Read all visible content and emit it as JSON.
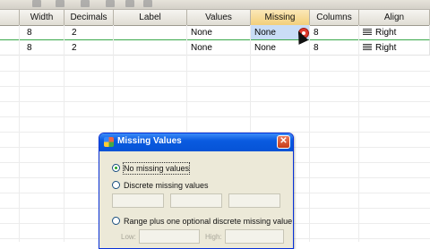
{
  "grid": {
    "columns": [
      "Width",
      "Decimals",
      "Label",
      "Values",
      "Missing",
      "Columns",
      "Align"
    ],
    "rows": [
      {
        "width": "8",
        "decimals": "2",
        "label": "",
        "values": "None",
        "missing": "None",
        "columns": "8",
        "align": "Right"
      },
      {
        "width": "8",
        "decimals": "2",
        "label": "",
        "values": "None",
        "missing": "None",
        "columns": "8",
        "align": "Right"
      }
    ]
  },
  "dialog": {
    "title": "Missing Values",
    "close": "✕",
    "options": {
      "none": "No missing values",
      "discrete": "Discrete missing values",
      "range": "Range plus one optional discrete missing value"
    },
    "range_fields": {
      "low": "Low:",
      "high": "High:"
    },
    "selected_option": "none"
  },
  "colors": {
    "accent": "#0a5be0",
    "selection": "#c9ddf6",
    "badge": "#e03a2e"
  }
}
